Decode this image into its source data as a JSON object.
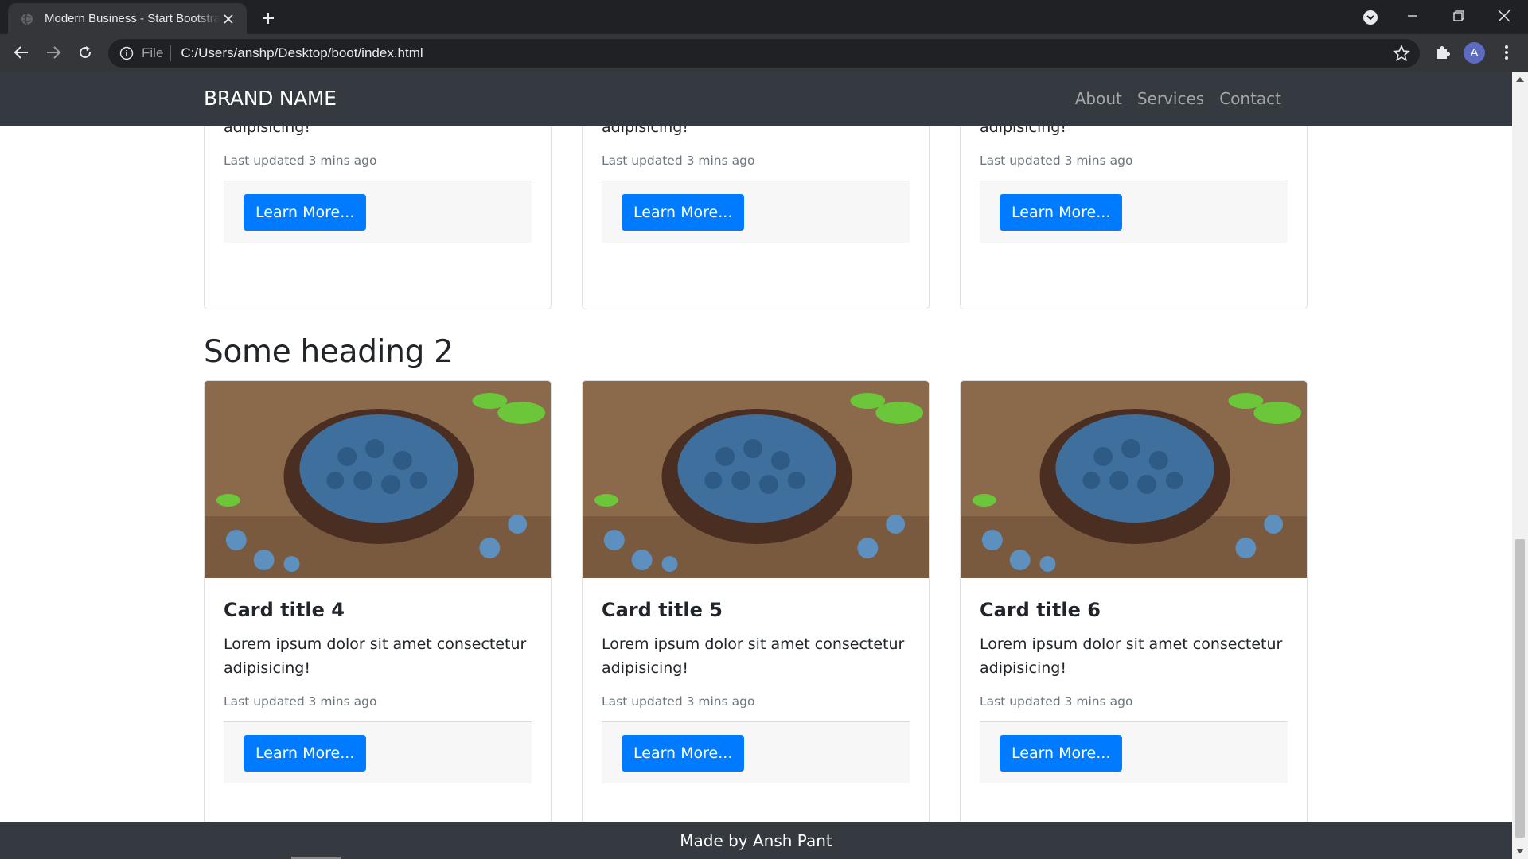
{
  "browser": {
    "tab_title": "Modern Business - Start Bootstrap",
    "url_scheme": "File",
    "url_path": "C:/Users/anshp/Desktop/boot/index.html",
    "profile_initial": "A"
  },
  "navbar": {
    "brand": "BRAND NAME",
    "links": [
      "About",
      "Services",
      "Contact"
    ]
  },
  "section_top": {
    "cards": [
      {
        "text": "Lorem ipsum dolor sit amet consectetur adipisicing!",
        "updated": "Last updated 3 mins ago",
        "button": "Learn More..."
      },
      {
        "text": "Lorem ipsum dolor sit amet consectetur adipisicing!",
        "updated": "Last updated 3 mins ago",
        "button": "Learn More..."
      },
      {
        "text": "Lorem ipsum dolor sit amet consectetur adipisicing!",
        "updated": "Last updated 3 mins ago",
        "button": "Learn More..."
      }
    ]
  },
  "section_2": {
    "heading": "Some heading 2",
    "cards": [
      {
        "title": "Card title 4",
        "text": "Lorem ipsum dolor sit amet consectetur adipisicing!",
        "updated": "Last updated 3 mins ago",
        "button": "Learn More..."
      },
      {
        "title": "Card title 5",
        "text": "Lorem ipsum dolor sit amet consectetur adipisicing!",
        "updated": "Last updated 3 mins ago",
        "button": "Learn More..."
      },
      {
        "title": "Card title 6",
        "text": "Lorem ipsum dolor sit amet consectetur adipisicing!",
        "updated": "Last updated 3 mins ago",
        "button": "Learn More..."
      }
    ]
  },
  "footer": {
    "text": "Made by Ansh Pant"
  },
  "colors": {
    "navbar_bg": "#343a40",
    "primary_button": "#007bff",
    "muted_text": "#6c757d"
  }
}
